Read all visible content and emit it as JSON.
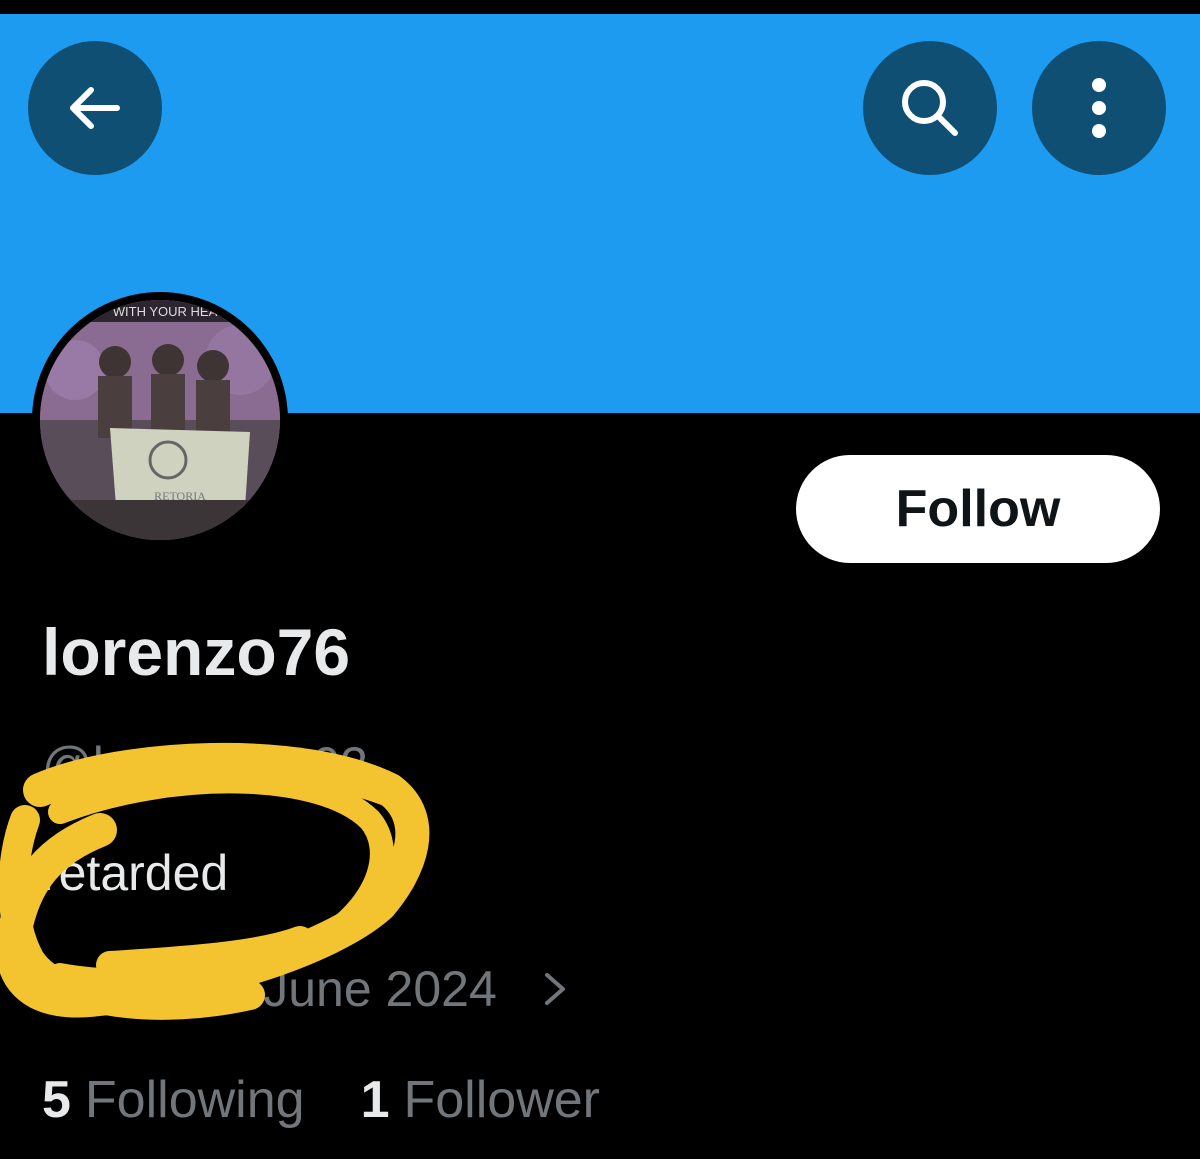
{
  "header": {
    "back_icon": "arrow-left-icon",
    "search_icon": "search-icon",
    "more_icon": "more-vertical-icon",
    "banner_color": "#1d9bf0",
    "button_color": "#0f4f74"
  },
  "avatar": {
    "banner_text": "WITH YOUR HEA",
    "flag_text": "RETORIA"
  },
  "profile": {
    "follow_label": "Follow",
    "display_name": "lorenzo76",
    "handle": "@lorenzo0102",
    "bio": "retarded",
    "joined": "Joined June 2024",
    "joined_icon": "calendar-icon"
  },
  "stats": {
    "following_count": "5",
    "following_label": "Following",
    "followers_count": "1",
    "followers_label": "Follower"
  },
  "annotation": {
    "scribble_color": "#f4c430"
  }
}
